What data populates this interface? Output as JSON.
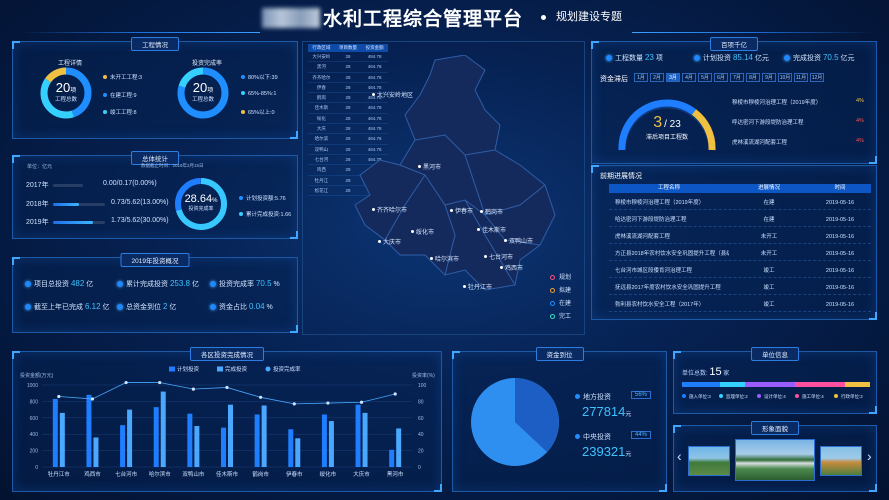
{
  "header": {
    "title": "水利工程综合管理平台",
    "subtitle": "规划建设专题"
  },
  "panel_overview": {
    "title": "工程情况",
    "left": {
      "label": "工程详情",
      "value": "20",
      "unit": "项",
      "caption": "工程总数",
      "legend": [
        {
          "label": "未开工工程:3",
          "color": "#f0c040"
        },
        {
          "label": "在建工程:9",
          "color": "#1f8fff"
        },
        {
          "label": "竣工工程:8",
          "color": "#36d0ff"
        }
      ]
    },
    "right": {
      "label": "投资完成率",
      "value": "20",
      "unit": "项",
      "caption": "工程总数",
      "legend": [
        {
          "label": "80%以下:39",
          "color": "#1f8fff"
        },
        {
          "label": "65%-85%:1",
          "color": "#36d0ff"
        },
        {
          "label": "65%以上:0",
          "color": "#f0c040"
        }
      ]
    }
  },
  "panel_total": {
    "title": "总体统计",
    "unit_label": "单位：亿元",
    "note": "数据截止时间：2019年2月15日",
    "rows": [
      {
        "year": "2017年",
        "text": "0.00/0.17(0.00%)",
        "pct": 0.0
      },
      {
        "year": "2018年",
        "text": "0.73/5.62(13.00%)",
        "pct": 0.13
      },
      {
        "year": "2019年",
        "text": "1.73/5.62(30.00%)",
        "pct": 0.3
      }
    ],
    "ring_value": "28.64",
    "ring_unit": "%",
    "ring_caption": "投资完成率",
    "legend": [
      {
        "label": "计划投资额:5.76",
        "color": "#1f8fff"
      },
      {
        "label": "累计完成投资:1.66",
        "color": "#36d0ff"
      }
    ]
  },
  "panel_invest": {
    "title": "2019年投资概况",
    "items": [
      {
        "label": "项目总投资",
        "value": "482",
        "unit": "亿"
      },
      {
        "label": "累计完成投资",
        "value": "253.8",
        "unit": "亿"
      },
      {
        "label": "投资完成率",
        "value": "70.5",
        "unit": "%"
      },
      {
        "label": "截至上年已完成",
        "value": "6.12",
        "unit": "亿"
      },
      {
        "label": "总资金到位",
        "value": "2",
        "unit": "亿"
      },
      {
        "label": "资金占比",
        "value": "0.04",
        "unit": "%"
      }
    ]
  },
  "map_table": {
    "headers": [
      "行政区域",
      "项目数量",
      "投资金额"
    ],
    "rows": [
      [
        "大兴安岭",
        "28",
        "484.78"
      ],
      [
        "黑河",
        "28",
        "484.78"
      ],
      [
        "齐齐哈尔",
        "28",
        "484.78"
      ],
      [
        "伊春",
        "28",
        "484.78"
      ],
      [
        "鹤岗",
        "28",
        "484.78"
      ],
      [
        "佳木斯",
        "28",
        "484.78"
      ],
      [
        "绥化",
        "28",
        "484.78"
      ],
      [
        "大庆",
        "28",
        "484.78"
      ],
      [
        "哈尔滨",
        "28",
        "484.78"
      ],
      [
        "双鸭山",
        "28",
        "484.78"
      ],
      [
        "七台河",
        "28",
        "484.78"
      ],
      [
        "鸡西",
        "28",
        "484.78"
      ],
      [
        "牡丹江",
        "28",
        "484.78"
      ],
      [
        "松花江",
        "28",
        "484.78"
      ]
    ]
  },
  "map": {
    "cities": [
      "大兴安岭地区",
      "黑河市",
      "齐齐哈尔市",
      "伊春市",
      "鹤岗市",
      "佳木斯市",
      "绥化市",
      "大庆市",
      "哈尔滨市",
      "双鸭山市",
      "七台河市",
      "鸡西市",
      "牡丹江市"
    ],
    "legend": [
      {
        "label": "规划",
        "color": "#ff4f7b"
      },
      {
        "label": "拟建",
        "color": "#f0a030"
      },
      {
        "label": "在建",
        "color": "#1f8fff"
      },
      {
        "label": "完工",
        "color": "#36e0c0"
      }
    ]
  },
  "panel_project": {
    "title": "百项千亿",
    "count_label": "工程数量",
    "count_value": "23",
    "count_unit": "项",
    "plan_label": "计划投资",
    "plan_value": "85.14",
    "plan_unit": "亿元",
    "done_label": "完成投资",
    "done_value": "70.5",
    "done_unit": "亿元",
    "lag_label": "资金滞后",
    "months": [
      "1月",
      "2月",
      "3月",
      "4月",
      "5月",
      "6月",
      "7月",
      "8月",
      "9月",
      "10月",
      "11月",
      "12月"
    ],
    "active_month": 2,
    "gauge_value": "3",
    "gauge_total": "/ 23",
    "gauge_caption": "滞后项目工程数",
    "lag_items": [
      {
        "name": "穆棱市穆棱河治理工程（2019年度）",
        "pct": "4%",
        "color": "#f0c040"
      },
      {
        "name": "呼达密河下游段堤防治理工程",
        "pct": "4%",
        "color": "#ff4f4f"
      },
      {
        "name": "虎林溪流湖河配套工程",
        "pct": "4%",
        "color": "#ff4f4f"
      }
    ]
  },
  "progress": {
    "title": "前期进展情况",
    "headers": [
      "工程名称",
      "进展情况",
      "时间"
    ],
    "rows": [
      [
        "穆棱市穆棱河治理工程（2019年度）",
        "在建",
        "2019-05-16"
      ],
      [
        "哈达密河下游段堤防治理工程",
        "在建",
        "2019-05-16"
      ],
      [
        "虎林溪流湖河配套工程",
        "未开工",
        "2019-05-16"
      ],
      [
        "方正县2018年农村饮水安全巩固提升工程（县级）",
        "未开工",
        "2019-05-16"
      ],
      [
        "七台河市城区段倭肯河治理工程",
        "竣工",
        "2019-05-16"
      ],
      [
        "抚远县2017年度农村饮水安全巩固提升工程",
        "竣工",
        "2019-05-16"
      ],
      [
        "勃利县农村饮水安全工程（2017年）",
        "竣工",
        "2019-05-16"
      ]
    ]
  },
  "chart_data": {
    "type": "bar",
    "title": "各区投资完成情况",
    "ylabel": "投资金额(万元)",
    "y2label": "投资率(%)",
    "ylim": [
      0,
      1000
    ],
    "y2lim": [
      0,
      100
    ],
    "yticks": [
      "1000",
      "800",
      "600",
      "400",
      "200",
      "0"
    ],
    "y2ticks": [
      "100",
      "80",
      "60",
      "40",
      "20",
      "0"
    ],
    "categories": [
      "牡丹江市",
      "鸡西市",
      "七台河市",
      "哈尔滨市",
      "双鸭山市",
      "佳木斯市",
      "鹤岗市",
      "伊春市",
      "绥化市",
      "大庆市",
      "黑河市"
    ],
    "series": [
      {
        "name": "计划投资",
        "color": "#1f7dff",
        "values": [
          830,
          880,
          510,
          730,
          650,
          480,
          640,
          460,
          640,
          760,
          210
        ]
      },
      {
        "name": "完成投资",
        "color": "#4aa8ff",
        "values": [
          660,
          360,
          700,
          920,
          500,
          760,
          750,
          350,
          560,
          660,
          470
        ]
      },
      {
        "name": "投资完成率",
        "type": "line",
        "color": "#4aa8ff",
        "values": [
          86,
          83,
          103,
          103,
          95,
          97,
          85,
          77,
          78,
          79,
          89
        ]
      }
    ]
  },
  "panel_funds": {
    "title": "资金到位",
    "items": [
      {
        "label": "地方投资",
        "pct": "56%",
        "value": "277814",
        "unit": "元"
      },
      {
        "label": "中央投资",
        "pct": "44%",
        "value": "239321",
        "unit": "元"
      }
    ]
  },
  "panel_unit": {
    "title": "单位信息",
    "label": "单位总数",
    "value": "15",
    "unit": "家",
    "legend": [
      {
        "label": "施入单位:3",
        "color": "#1f7dff"
      },
      {
        "label": "监理单位:2",
        "color": "#36d0ff"
      },
      {
        "label": "设计单位:4",
        "color": "#9a5cff"
      },
      {
        "label": "施工单位:4",
        "color": "#ff4fa0"
      },
      {
        "label": "行政单位:2",
        "color": "#f0c040"
      }
    ]
  },
  "panel_photo": {
    "title": "形象面貌",
    "prev": "‹",
    "next": "›"
  }
}
